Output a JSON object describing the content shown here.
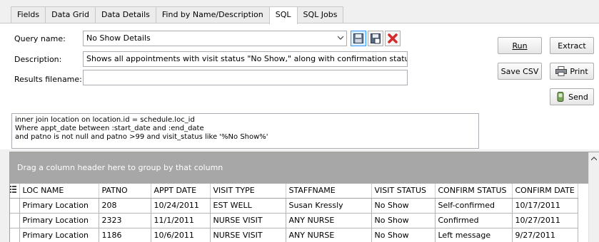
{
  "tabs": [
    {
      "label": "Fields",
      "active": false
    },
    {
      "label": "Data Grid",
      "active": false
    },
    {
      "label": "Data Details",
      "active": false
    },
    {
      "label": "Find by Name/Description",
      "active": false
    },
    {
      "label": "SQL",
      "active": true
    },
    {
      "label": "SQL Jobs",
      "active": false
    }
  ],
  "form": {
    "query_name_label": "Query name:",
    "query_name_value": "No Show Details",
    "description_label": "Description:",
    "description_value": "Shows all appointments with visit status \"No Show,\" along with confirmation status",
    "results_label": "Results filename:",
    "results_value": ""
  },
  "sql_text": "inner join location on location.id = schedule.loc_id\nWhere appt_date between :start_date and :end_date\nand patno is not null and patno >99 and visit_status like '%No Show%'",
  "buttons": {
    "run": "Run",
    "extract": "Extract",
    "save_csv": "Save CSV",
    "print": "Print",
    "send": "Send"
  },
  "grid": {
    "group_hint": "Drag a column header here to group by that column",
    "columns": [
      "LOC NAME",
      "PATNO",
      "APPT DATE",
      "VISIT TYPE",
      "STAFFNAME",
      "VISIT STATUS",
      "CONFIRM STATUS",
      "CONFIRM DATE"
    ],
    "rows": [
      [
        "Primary Location",
        "208",
        "10/24/2011",
        "EST WELL",
        "Susan Kressly",
        "No Show",
        "Self-confirmed",
        "10/17/2011"
      ],
      [
        "Primary Location",
        "2323",
        "11/1/2011",
        "NURSE VISIT",
        "ANY NURSE",
        "No Show",
        "Confirmed",
        "10/27/2011"
      ],
      [
        "Primary Location",
        "1186",
        "10/6/2011",
        "NURSE VISIT",
        "ANY NURSE",
        "No Show",
        "Left message",
        "9/27/2011"
      ]
    ]
  },
  "icons": {
    "combo": "chevron-down-icon",
    "save": "save-icon",
    "save_as": "save-as-icon",
    "delete": "delete-icon",
    "print": "printer-icon",
    "send": "send-icon",
    "scroll_up": "scroll-up-icon",
    "column_chooser": "column-chooser-icon"
  },
  "colors": {
    "delete_red": "#d42a2a",
    "group_panel": "#a7a7a7",
    "selection_blue": "#3399ff"
  }
}
